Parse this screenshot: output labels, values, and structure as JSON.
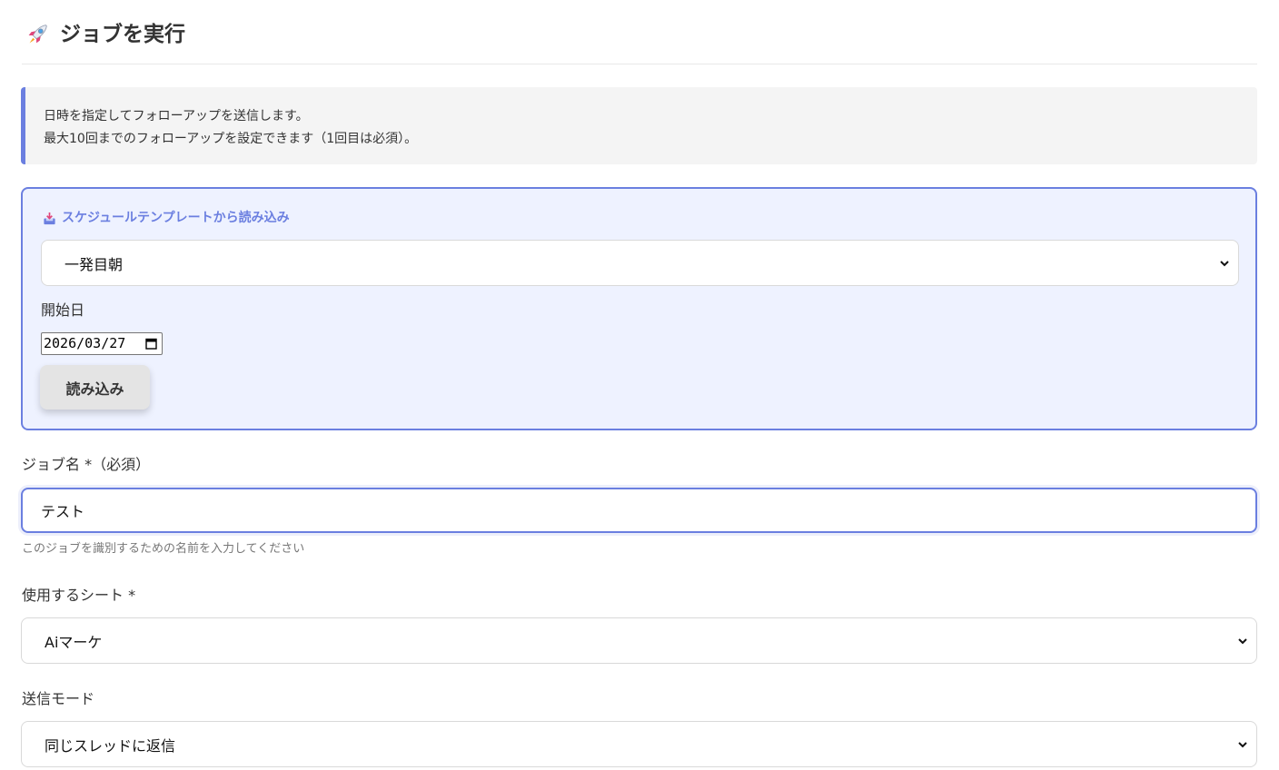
{
  "header": {
    "icon": "rocket-icon",
    "title": "ジョブを実行"
  },
  "info": {
    "line1": "日時を指定してフォローアップを送信します。",
    "line2": "最大10回までのフォローアップを設定できます（1回目は必須）。",
    "accent_color": "#6b7fe0"
  },
  "template_section": {
    "icon": "inbox-tray-icon",
    "title": "スケジュールテンプレートから読み込み",
    "template_select": {
      "selected": "一発目朝"
    },
    "start_date": {
      "label": "開始日",
      "value": "2026/03/27"
    },
    "load_button": "読み込み"
  },
  "form": {
    "job_name": {
      "label": "ジョブ名 *（必須）",
      "value": "テスト",
      "hint": "このジョブを識別するための名前を入力してください"
    },
    "sheet": {
      "label": "使用するシート *",
      "selected": "Aiマーケ"
    },
    "send_mode": {
      "label": "送信モード",
      "selected": "同じスレッドに返信"
    }
  }
}
